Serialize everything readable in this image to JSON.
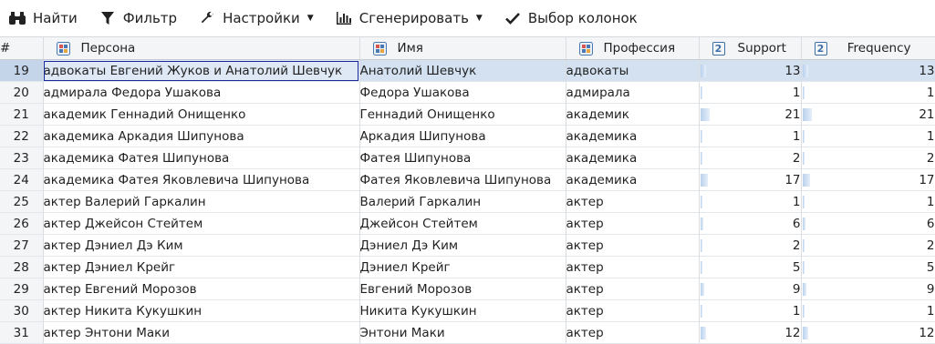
{
  "toolbar": {
    "find": "Найти",
    "filter": "Фильтр",
    "settings": "Настройки",
    "generate": "Сгенерировать",
    "columns": "Выбор колонок"
  },
  "columns": {
    "index": "#",
    "person": "Персона",
    "name": "Имя",
    "profession": "Профессия",
    "support": "Support",
    "frequency": "Frequency",
    "num_type_icon": "2"
  },
  "rows": [
    {
      "n": "19",
      "person": "адвокаты Евгений Жуков и Анатолий Шевчук",
      "name": "Анатолий Шевчук",
      "profession": "адвокаты",
      "support": "13",
      "frequency": "13"
    },
    {
      "n": "20",
      "person": "адмирала Федора Ушакова",
      "name": "Федора Ушакова",
      "profession": "адмирала",
      "support": "1",
      "frequency": "1"
    },
    {
      "n": "21",
      "person": "академик Геннадий Онищенко",
      "name": "Геннадий Онищенко",
      "profession": "академик",
      "support": "21",
      "frequency": "21"
    },
    {
      "n": "22",
      "person": "академика Аркадия Шипунова",
      "name": "Аркадия Шипунова",
      "profession": "академика",
      "support": "1",
      "frequency": "1"
    },
    {
      "n": "23",
      "person": "академика Фатея Шипунова",
      "name": "Фатея Шипунова",
      "profession": "академика",
      "support": "2",
      "frequency": "2"
    },
    {
      "n": "24",
      "person": "академика Фатея Яковлевича Шипунова",
      "name": "Фатея Яковлевича Шипунова",
      "profession": "академика",
      "support": "17",
      "frequency": "17"
    },
    {
      "n": "25",
      "person": "актер Валерий Гаркалин",
      "name": "Валерий Гаркалин",
      "profession": "актер",
      "support": "1",
      "frequency": "1"
    },
    {
      "n": "26",
      "person": "актер Джейсон Стейтем",
      "name": "Джейсон Стейтем",
      "profession": "актер",
      "support": "6",
      "frequency": "6"
    },
    {
      "n": "27",
      "person": "актер Дэниел Дэ Ким",
      "name": "Дэниел Дэ Ким",
      "profession": "актер",
      "support": "2",
      "frequency": "2"
    },
    {
      "n": "28",
      "person": "актер Дэниел Крейг",
      "name": "Дэниел Крейг",
      "profession": "актер",
      "support": "5",
      "frequency": "5"
    },
    {
      "n": "29",
      "person": "актер Евгений Морозов",
      "name": "Евгений Морозов",
      "profession": "актер",
      "support": "9",
      "frequency": "9"
    },
    {
      "n": "30",
      "person": "актер Никита Кукушкин",
      "name": "Никита Кукушкин",
      "profession": "актер",
      "support": "1",
      "frequency": "1"
    },
    {
      "n": "31",
      "person": "актер Энтони Маки",
      "name": "Энтони Маки",
      "profession": "актер",
      "support": "12",
      "frequency": "12"
    }
  ],
  "selected_row": "19",
  "colors": {
    "accent": "#3e6fa8",
    "selection": "#d3e1f1",
    "focus_border": "#1a2a9e"
  }
}
